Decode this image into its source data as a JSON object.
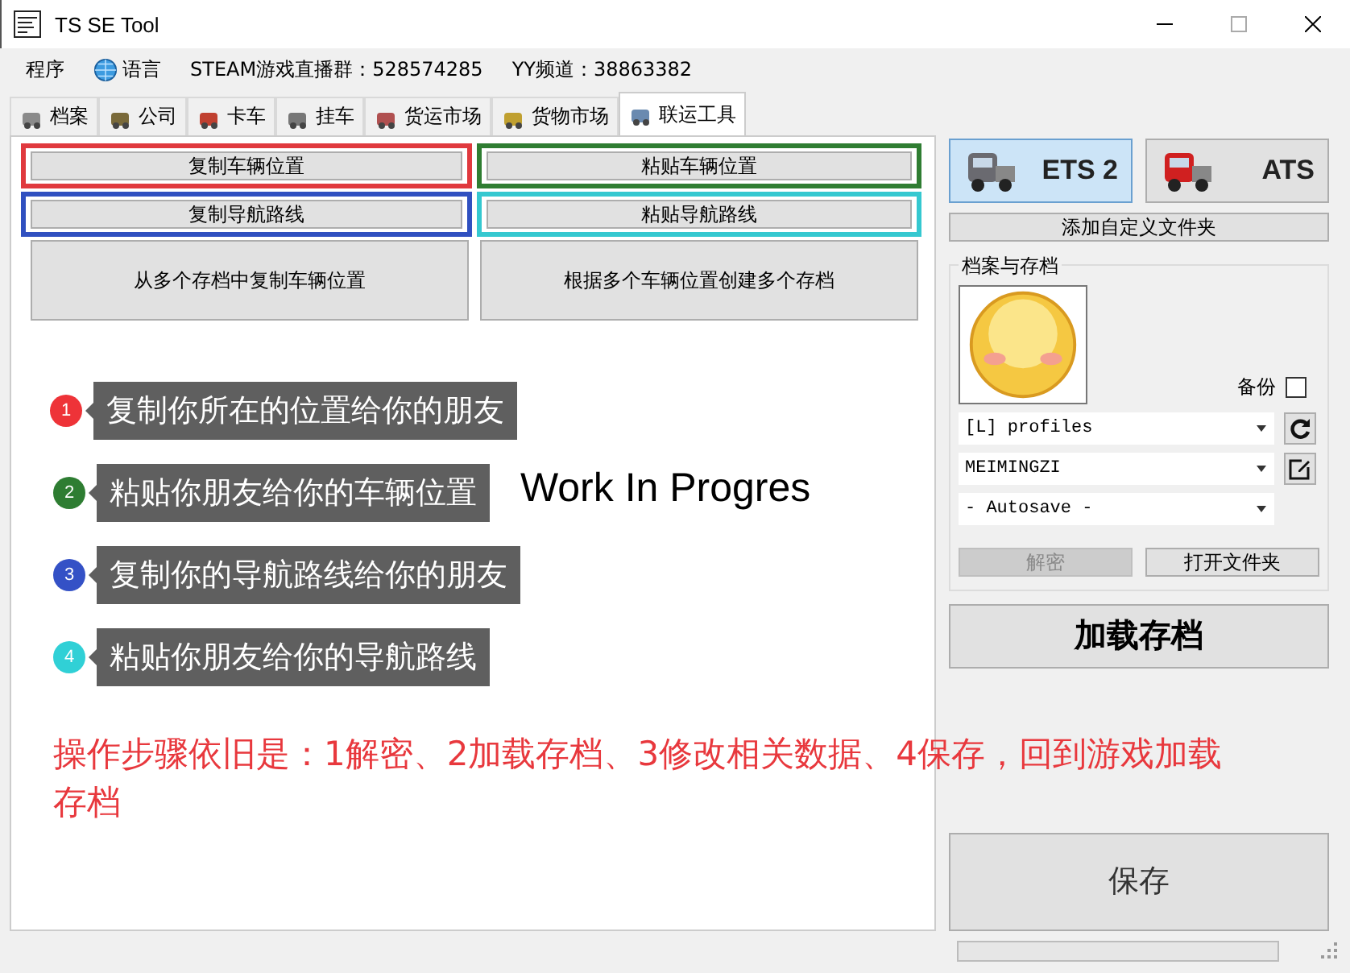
{
  "window": {
    "title": "TS SE Tool"
  },
  "menu": [
    {
      "label": "程序",
      "kind": "text"
    },
    {
      "label": "语言",
      "kind": "globe"
    },
    {
      "label": "STEAM游戏直播群：528574285",
      "kind": "text"
    },
    {
      "label": "YY频道：38863382",
      "kind": "text"
    }
  ],
  "tabs": [
    {
      "label": "档案",
      "selected": false
    },
    {
      "label": "公司",
      "selected": false
    },
    {
      "label": "卡车",
      "selected": false
    },
    {
      "label": "挂车",
      "selected": false
    },
    {
      "label": "货运市场",
      "selected": false
    },
    {
      "label": "货物市场",
      "selected": false
    },
    {
      "label": "联运工具",
      "selected": true
    }
  ],
  "actions": [
    {
      "label": "复制车辆位置",
      "color": "#e0393e"
    },
    {
      "label": "粘贴车辆位置",
      "color": "#2f7d32"
    },
    {
      "label": "复制导航路线",
      "color": "#3050c0"
    },
    {
      "label": "粘贴导航路线",
      "color": "#35c8d0"
    }
  ],
  "large_actions": [
    "从多个存档中复制车辆位置",
    "根据多个车辆位置创建多个存档"
  ],
  "watermark_text": "Work In Progres",
  "steps": [
    {
      "number": "1",
      "text": "复制你所在的位置给你的朋友",
      "color": "#ee3338"
    },
    {
      "number": "2",
      "text": "粘贴你朋友给你的车辆位置",
      "color": "#2e7d32"
    },
    {
      "number": "3",
      "text": "复制你的导航路线给你的朋友",
      "color": "#3451c6"
    },
    {
      "number": "4",
      "text": "粘贴你朋友给你的导航路线",
      "color": "#30d0d6"
    }
  ],
  "note": "操作步骤依旧是：1解密、2加载存档、3修改相关数据、4保存，回到游戏加载存档",
  "games": [
    {
      "label": "ETS 2",
      "selected": true
    },
    {
      "label": "ATS",
      "selected": false
    }
  ],
  "add_folder": "添加自定义文件夹",
  "profiles_group": {
    "title": "档案与存档",
    "backup": {
      "label": "备份",
      "checked": false
    },
    "dropdowns": [
      {
        "value": "[L] profiles",
        "kind": "refresh"
      },
      {
        "value": "MEIMINGZI",
        "kind": "edit"
      },
      {
        "value": "- Autosave -",
        "kind": "plain"
      }
    ],
    "buttons": [
      {
        "label": "解密",
        "disabled": true
      },
      {
        "label": "打开文件夹",
        "disabled": false
      }
    ]
  },
  "load_button": "加载存档",
  "save_button": "保存",
  "progress": {
    "level": 0
  }
}
